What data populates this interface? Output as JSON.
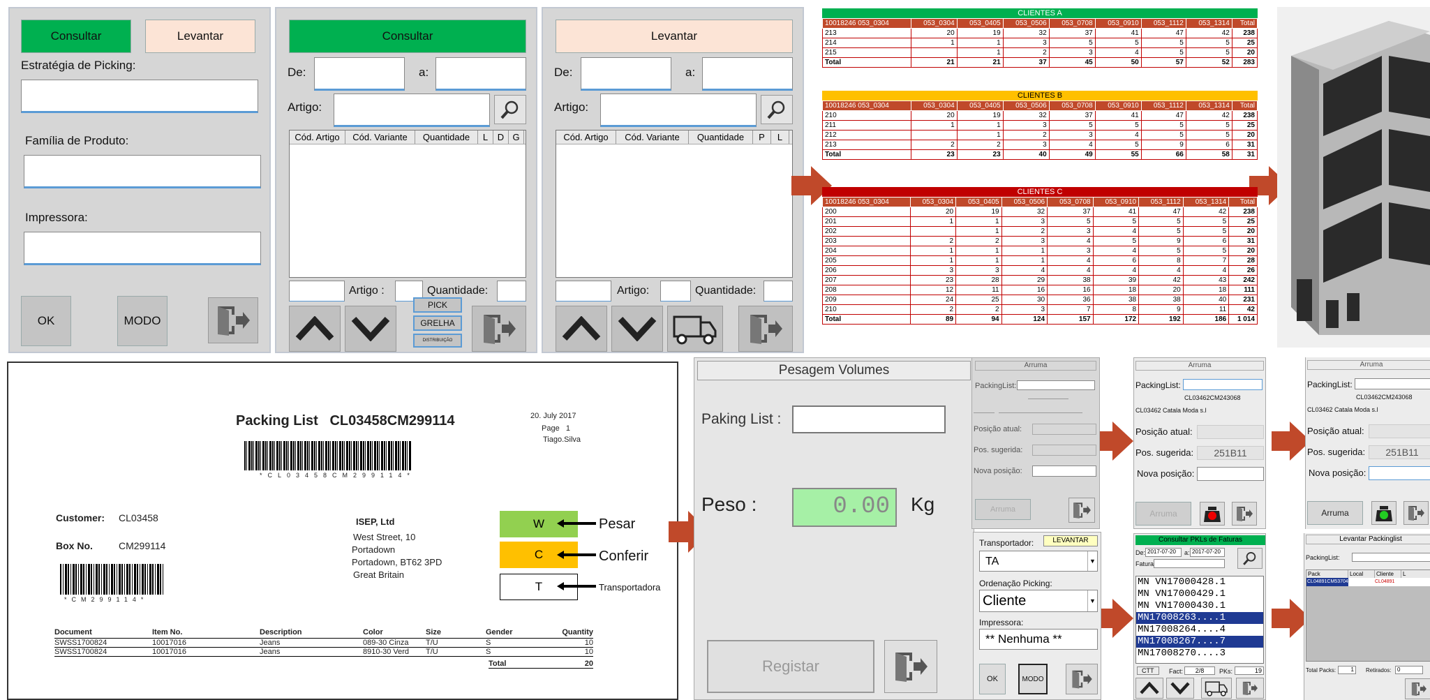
{
  "screen1": {
    "consultar": "Consultar",
    "levantar": "Levantar",
    "estrategia": "Estratégia de Picking:",
    "familia": "Família de Produto:",
    "impressora": "Impressora:",
    "ok": "OK",
    "modo": "MODO"
  },
  "screen2": {
    "consultar": "Consultar",
    "de": "De:",
    "a": "a:",
    "artigo": "Artigo:",
    "cols": [
      "Cód. Artigo",
      "Cód. Variante",
      "Quantidade",
      "L",
      "D",
      "G"
    ],
    "artigo_bottom": "Artigo :",
    "quantidade": "Quantidade:",
    "pick": "PICK",
    "grelha": "GRELHA",
    "distribuicao": "DISTRIBUIÇÃO"
  },
  "screen3": {
    "levantar": "Levantar",
    "de": "De:",
    "a": "a:",
    "artigo": "Artigo:",
    "cols": [
      "Cód. Artigo",
      "Cód. Variante",
      "Quantidade",
      "P",
      "L"
    ],
    "artigo_bottom": "Artigo:",
    "quantidade": "Quantidade:"
  },
  "tableA": {
    "title": "CLIENTES A",
    "header": [
      "10018246 053_0304",
      "053_0304",
      "053_0405",
      "053_0506",
      "053_0708",
      "053_0910",
      "053_1112",
      "053_1314",
      "Total"
    ],
    "rows": [
      [
        "213",
        "20",
        "19",
        "32",
        "37",
        "41",
        "47",
        "42",
        "238"
      ],
      [
        "214",
        "1",
        "1",
        "3",
        "5",
        "5",
        "5",
        "5",
        "25"
      ],
      [
        "215",
        "",
        "1",
        "2",
        "3",
        "4",
        "5",
        "5",
        "20"
      ],
      [
        "Total",
        "21",
        "21",
        "37",
        "45",
        "50",
        "57",
        "52",
        "283"
      ]
    ]
  },
  "tableB": {
    "title": "CLIENTES B",
    "header": [
      "10018246 053_0304",
      "053_0304",
      "053_0405",
      "053_0506",
      "053_0708",
      "053_0910",
      "053_1112",
      "053_1314",
      "Total"
    ],
    "rows": [
      [
        "210",
        "20",
        "19",
        "32",
        "37",
        "41",
        "47",
        "42",
        "238"
      ],
      [
        "211",
        "1",
        "1",
        "3",
        "5",
        "5",
        "5",
        "5",
        "25"
      ],
      [
        "212",
        "",
        "1",
        "2",
        "3",
        "4",
        "5",
        "5",
        "20"
      ],
      [
        "213",
        "2",
        "2",
        "3",
        "4",
        "5",
        "9",
        "6",
        "31"
      ],
      [
        "Total",
        "23",
        "23",
        "40",
        "49",
        "55",
        "66",
        "58",
        "31"
      ]
    ]
  },
  "tableC": {
    "title": "CLIENTES C",
    "header": [
      "10018246 053_0304",
      "053_0304",
      "053_0405",
      "053_0506",
      "053_0708",
      "053_0910",
      "053_1112",
      "053_1314",
      "Total"
    ],
    "rows": [
      [
        "200",
        "20",
        "19",
        "32",
        "37",
        "41",
        "47",
        "42",
        "238"
      ],
      [
        "201",
        "1",
        "1",
        "3",
        "5",
        "5",
        "5",
        "5",
        "25"
      ],
      [
        "202",
        "",
        "1",
        "2",
        "3",
        "4",
        "5",
        "5",
        "20"
      ],
      [
        "203",
        "2",
        "2",
        "3",
        "4",
        "5",
        "9",
        "6",
        "31"
      ],
      [
        "204",
        "1",
        "1",
        "1",
        "3",
        "4",
        "5",
        "5",
        "20"
      ],
      [
        "205",
        "1",
        "1",
        "1",
        "4",
        "6",
        "8",
        "7",
        "28"
      ],
      [
        "206",
        "3",
        "3",
        "4",
        "4",
        "4",
        "4",
        "4",
        "26"
      ],
      [
        "207",
        "23",
        "28",
        "29",
        "38",
        "39",
        "42",
        "43",
        "242"
      ],
      [
        "208",
        "12",
        "11",
        "16",
        "16",
        "18",
        "20",
        "18",
        "111"
      ],
      [
        "209",
        "24",
        "25",
        "30",
        "36",
        "38",
        "38",
        "40",
        "231"
      ],
      [
        "210",
        "2",
        "2",
        "3",
        "7",
        "8",
        "9",
        "11",
        "42"
      ],
      [
        "Total",
        "89",
        "94",
        "124",
        "157",
        "172",
        "192",
        "186",
        "1 014"
      ]
    ]
  },
  "packing": {
    "title": "Packing List",
    "code": "CL03458CM299114",
    "date": "20. July 2017",
    "page_label": "Page",
    "page": "1",
    "user": "Tiago.Silva",
    "barcode_text": "*CL03458CM299114*",
    "customer_label": "Customer:",
    "customer": "CL03458",
    "box_label": "Box No.",
    "box": "CM299114",
    "box_barcode_text": "*CM299114*",
    "company": "ISEP, Ltd",
    "address": [
      "West Street, 10",
      "Portadown",
      "Portadown, BT62 3PD",
      "Great Britain"
    ],
    "cols": [
      "Document",
      "Item No.",
      "Description",
      "Color",
      "Size",
      "Gender",
      "Quantity"
    ],
    "rows": [
      [
        "SWSS1700824",
        "10017016",
        "Jeans",
        "089-30 Cinza",
        "T/U",
        "S",
        "10"
      ],
      [
        "SWSS1700824",
        "10017016",
        "Jeans",
        "8910-30 Verd",
        "T/U",
        "S",
        "10"
      ]
    ],
    "total_label": "Total",
    "total": "20",
    "legend": [
      {
        "letter": "W",
        "text": "Pesar"
      },
      {
        "letter": "C",
        "text": "Conferir"
      },
      {
        "letter": "T",
        "text": "Transportadora"
      }
    ]
  },
  "pesagem": {
    "title": "Pesagem Volumes",
    "paking": "Paking List :",
    "peso": "Peso :",
    "value": "0.00",
    "unit": "Kg",
    "registar": "Registar"
  },
  "arruma1": {
    "title": "Arruma",
    "packinglist": "PackingList:",
    "posatual": "Posição atual:",
    "possug": "Pos. sugerida:",
    "novapos": "Nova posição:",
    "btn": "Arruma"
  },
  "arruma2": {
    "title": "Arruma",
    "packinglist": "PackingList:",
    "code": "CL03462CM243068",
    "client": "CL03462 Catala Moda s.l",
    "posatual": "Posição atual:",
    "possug": "Pos. sugerida:",
    "sug": "251B11",
    "novapos": "Nova posição:",
    "btn": "Arruma"
  },
  "arruma3": {
    "title": "Arruma",
    "packinglist": "PackingList:",
    "code": "CL03462CM243068",
    "client": "CL03462 Catala Moda s.l",
    "posatual": "Posição atual:",
    "possug": "Pos. sugerida:",
    "sug": "251B11",
    "novapos": "Nova posição:",
    "btn": "Arruma"
  },
  "transp": {
    "transportador": "Transportador:",
    "levantar": "LEVANTAR",
    "ta": "TA",
    "ordenacao": "Ordenação Picking:",
    "cliente": "Cliente",
    "impressora": "Impressora:",
    "nenhuma": "** Nenhuma **",
    "ok": "OK",
    "modo": "MODO"
  },
  "consultarpkl": {
    "title": "Consultar PKLs de Faturas",
    "de": "De:",
    "de_val": "2017-07-20",
    "a": "a:",
    "a_val": "2017-07-20",
    "fatura": "Fatura:",
    "items": [
      "MN VN17000428.1",
      "MN VN17000429.1",
      "MN VN17000430.1",
      "MN17008263....1",
      "MN17008264....4",
      "MN17008267....7",
      "MN17008270....3"
    ],
    "ctt": "CTT",
    "fact_label": "Fact:",
    "fact": "2/8",
    "pks_label": "PKs:",
    "pks": "19"
  },
  "levpack": {
    "title": "Levantar Packinglist",
    "packinglist": "PackingList:",
    "cols": [
      "Pack",
      "Local",
      "Cliente",
      "L"
    ],
    "row": [
      "CL04891CM537043",
      "",
      "CL04891",
      ""
    ],
    "total_packs_label": "Total Packs:",
    "total_packs": "1",
    "retirados_label": "Retirados:",
    "retirados": "0"
  },
  "colors": {
    "green": "#00b050",
    "peach": "#fce4d6",
    "arrow": "#c0492a",
    "red": "#c00000",
    "yellow": "#ffc000",
    "tgreen": "#00b050"
  }
}
